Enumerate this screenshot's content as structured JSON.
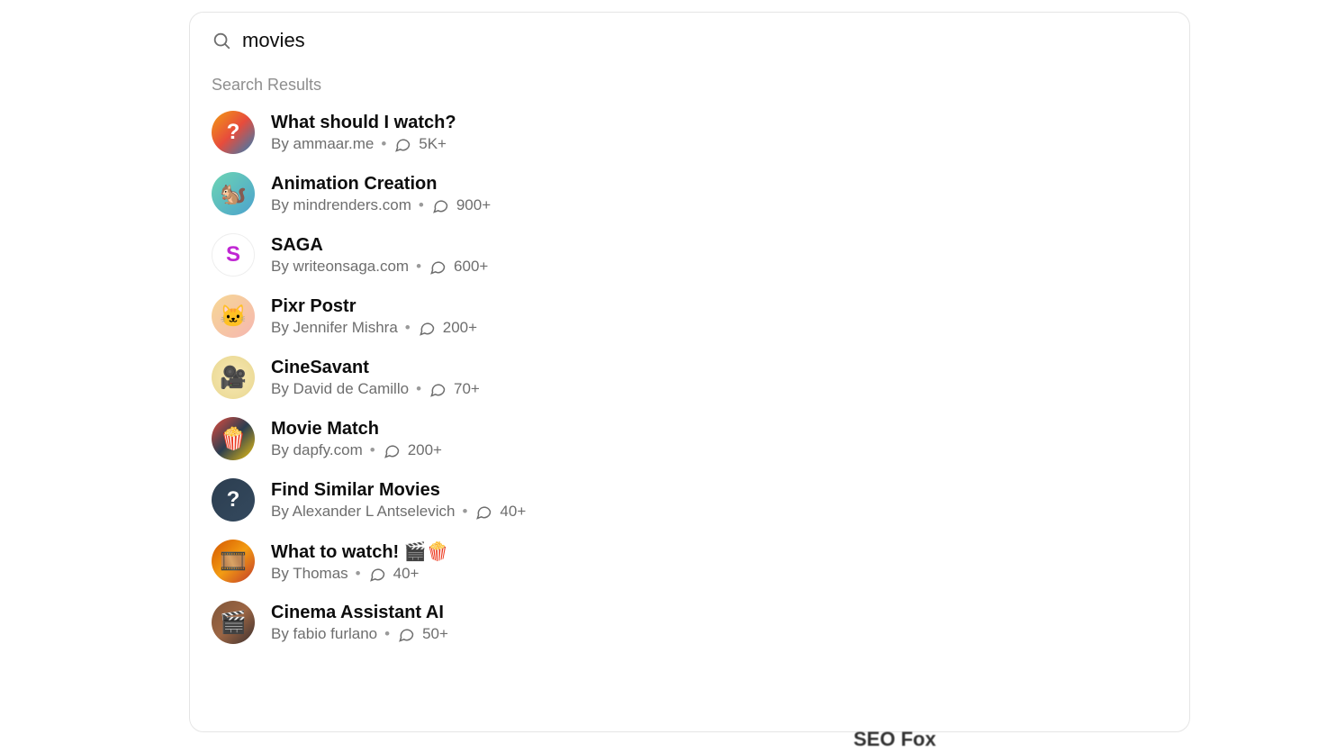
{
  "search": {
    "value": "movies",
    "results_label": "Search Results"
  },
  "results": [
    {
      "title": "What should I watch?",
      "author": "By ammaar.me",
      "count": "5K+",
      "avatar_glyph": "?"
    },
    {
      "title": "Animation Creation",
      "author": "By mindrenders.com",
      "count": "900+",
      "avatar_glyph": "🐿️"
    },
    {
      "title": "SAGA",
      "author": "By writeonsaga.com",
      "count": "600+",
      "avatar_glyph": "S"
    },
    {
      "title": "Pixr Postr",
      "author": "By Jennifer Mishra",
      "count": "200+",
      "avatar_glyph": "🐱"
    },
    {
      "title": "CineSavant",
      "author": "By David de Camillo",
      "count": "70+",
      "avatar_glyph": "🎥"
    },
    {
      "title": "Movie Match",
      "author": "By dapfy.com",
      "count": "200+",
      "avatar_glyph": "🍿"
    },
    {
      "title": "Find Similar Movies",
      "author": "By Alexander L Antselevich",
      "count": "40+",
      "avatar_glyph": "?"
    },
    {
      "title": "What to watch! 🎬🍿",
      "author": "By Thomas",
      "count": "40+",
      "avatar_glyph": "🎞️"
    },
    {
      "title": "Cinema Assistant AI",
      "author": "By fabio furlano",
      "count": "50+",
      "avatar_glyph": "🎬"
    }
  ],
  "background_text": "SEO Fox"
}
